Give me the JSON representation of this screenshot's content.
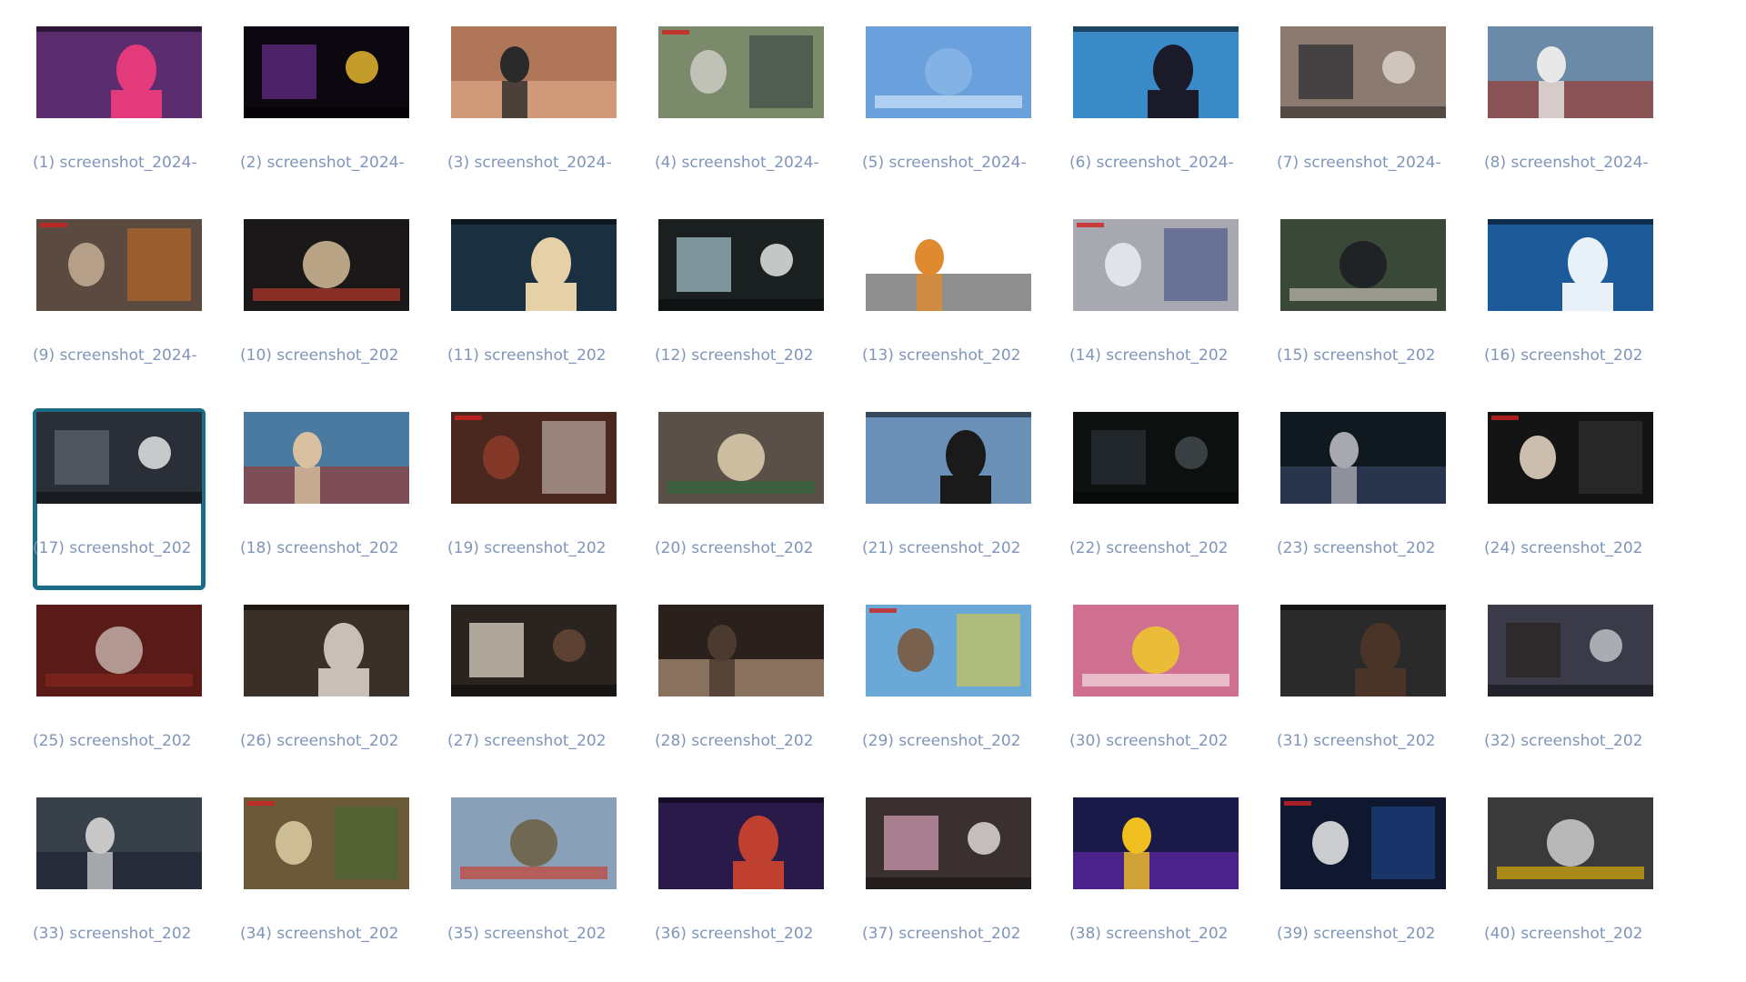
{
  "items": [
    {
      "label": "(1) screenshot_2024-",
      "icon": "studio-show-thumbnail"
    },
    {
      "label": "(2) screenshot_2024-",
      "icon": "dark-screen-thumbnail"
    },
    {
      "label": "(3) screenshot_2024-",
      "icon": "woman-phone-thumbnail"
    },
    {
      "label": "(4) screenshot_2024-",
      "icon": "reporter-field-thumbnail"
    },
    {
      "label": "(5) screenshot_2024-",
      "icon": "blue-screen-thumbnail"
    },
    {
      "label": "(6) screenshot_2024-",
      "icon": "news-anchor-thumbnail"
    },
    {
      "label": "(7) screenshot_2024-",
      "icon": "street-reporter-thumbnail"
    },
    {
      "label": "(8) screenshot_2024-",
      "icon": "motorcycle-thumbnail"
    },
    {
      "label": "(9) screenshot_2024-",
      "icon": "kitchen-thumbnail"
    },
    {
      "label": "(10) screenshot_202",
      "icon": "night-street-thumbnail"
    },
    {
      "label": "(11) screenshot_202",
      "icon": "blonde-woman-thumbnail"
    },
    {
      "label": "(12) screenshot_202",
      "icon": "monitor-scene-thumbnail"
    },
    {
      "label": "(13) screenshot_202",
      "icon": "white-screen-thumbnail"
    },
    {
      "label": "(14) screenshot_202",
      "icon": "woman-bathroom-thumbnail"
    },
    {
      "label": "(15) screenshot_202",
      "icon": "man-garden-thumbnail"
    },
    {
      "label": "(16) screenshot_202",
      "icon": "channel-logo-thumbnail"
    },
    {
      "label": "(17) screenshot_202",
      "icon": "car-ad-thumbnail"
    },
    {
      "label": "(18) screenshot_202",
      "icon": "boat-scene-thumbnail"
    },
    {
      "label": "(19) screenshot_202",
      "icon": "interview-thumbnail"
    },
    {
      "label": "(20) screenshot_202",
      "icon": "office-woman-thumbnail"
    },
    {
      "label": "(21) screenshot_202",
      "icon": "lab-woman-thumbnail"
    },
    {
      "label": "(22) screenshot_202",
      "icon": "dark-room-thumbnail"
    },
    {
      "label": "(23) screenshot_202",
      "icon": "dark-office-thumbnail"
    },
    {
      "label": "(24) screenshot_202",
      "icon": "conference-thumbnail"
    },
    {
      "label": "(25) screenshot_202",
      "icon": "red-room-thumbnail"
    },
    {
      "label": "(26) screenshot_202",
      "icon": "desk-man-thumbnail"
    },
    {
      "label": "(27) screenshot_202",
      "icon": "hallway-thumbnail"
    },
    {
      "label": "(28) screenshot_202",
      "icon": "closeup-woman-thumbnail"
    },
    {
      "label": "(29) screenshot_202",
      "icon": "cartoon-thumbnail"
    },
    {
      "label": "(30) screenshot_202",
      "icon": "cartoon-pink-thumbnail"
    },
    {
      "label": "(31) screenshot_202",
      "icon": "office-man-thumbnail"
    },
    {
      "label": "(32) screenshot_202",
      "icon": "office-pair-thumbnail"
    },
    {
      "label": "(33) screenshot_202",
      "icon": "office-table-thumbnail"
    },
    {
      "label": "(34) screenshot_202",
      "icon": "flood-street-thumbnail"
    },
    {
      "label": "(35) screenshot_202",
      "icon": "flood-field-thumbnail"
    },
    {
      "label": "(36) screenshot_202",
      "icon": "talk-show-thumbnail"
    },
    {
      "label": "(37) screenshot_202",
      "icon": "sofa-scene-thumbnail"
    },
    {
      "label": "(38) screenshot_202",
      "icon": "guide-screen-thumbnail"
    },
    {
      "label": "(39) screenshot_202",
      "icon": "epg-menu-thumbnail"
    },
    {
      "label": "(40) screenshot_202",
      "icon": "bw-scene-thumbnail"
    }
  ],
  "selected_index": 16,
  "thumbs": [
    {
      "bg": "#5b2c6e",
      "fg": "#e23a7a",
      "ac": "#8fd3f4"
    },
    {
      "bg": "#0c0810",
      "fg": "#6a2c8e",
      "ac": "#f0c030"
    },
    {
      "bg": "#b0765a",
      "fg": "#e4b090",
      "ac": "#2a2a2a"
    },
    {
      "bg": "#7a8a6a",
      "fg": "#2a2f3a",
      "ac": "#c8c8c0"
    },
    {
      "bg": "#6aa0dc",
      "fg": "#8ab6e6",
      "ac": "#e0ecf8"
    },
    {
      "bg": "#3a8ac8",
      "fg": "#1a1a28",
      "ac": "#e8c8b0"
    },
    {
      "bg": "#8a7a70",
      "fg": "#2a2a30",
      "ac": "#e0d8d0"
    },
    {
      "bg": "#6a8aa8",
      "fg": "#a03020",
      "ac": "#e8e8e8"
    },
    {
      "bg": "#5a4a40",
      "fg": "#d8701e",
      "ac": "#c0a890"
    },
    {
      "bg": "#1a1818",
      "fg": "#e0c8a0",
      "ac": "#d04030"
    },
    {
      "bg": "#1a3040",
      "fg": "#e6d0a8",
      "ac": "#3a6a8a"
    },
    {
      "bg": "#1a2020",
      "fg": "#a8c8d0",
      "ac": "#f0f0f0"
    },
    {
      "bg": "#ffffff",
      "fg": "#444444",
      "ac": "#e08a30"
    },
    {
      "bg": "#a8a8b0",
      "fg": "#2a3a7a",
      "ac": "#e8e8f0"
    },
    {
      "bg": "#3a4838",
      "fg": "#1a1a20",
      "ac": "#d8d0c8"
    },
    {
      "bg": "#1c5a9a",
      "fg": "#e8f0f8",
      "ac": "#4a88c8"
    },
    {
      "bg": "#2a2e36",
      "fg": "#606870",
      "ac": "#f0f0f0"
    },
    {
      "bg": "#4a7aa0",
      "fg": "#a03028",
      "ac": "#d8c0a0"
    },
    {
      "bg": "#4a2820",
      "fg": "#e8e0d8",
      "ac": "#8a3a28"
    },
    {
      "bg": "#5a5048",
      "fg": "#e8d8b8",
      "ac": "#2a6a3a"
    },
    {
      "bg": "#6a90b8",
      "fg": "#1a1a1a",
      "ac": "#e8d0c8"
    },
    {
      "bg": "#0e1010",
      "fg": "#2a3238",
      "ac": "#444c50"
    },
    {
      "bg": "#101820",
      "fg": "#3a4a6a",
      "ac": "#a8a8b0"
    },
    {
      "bg": "#141414",
      "fg": "#3a3a3a",
      "ac": "#e0d0c0"
    },
    {
      "bg": "#5a1a18",
      "fg": "#c8b8b0",
      "ac": "#8a2a20"
    },
    {
      "bg": "#3a3028",
      "fg": "#c8c0b8",
      "ac": "#6a5040"
    },
    {
      "bg": "#2a2420",
      "fg": "#e8e0d0",
      "ac": "#6a4a38"
    },
    {
      "bg": "#2a201c",
      "fg": "#c8a888",
      "ac": "#4a3a30"
    },
    {
      "bg": "#6aa8d8",
      "fg": "#f0d020",
      "ac": "#7a5a40"
    },
    {
      "bg": "#d07090",
      "fg": "#f0d020",
      "ac": "#f8f0f0"
    },
    {
      "bg": "#2a2a2a",
      "fg": "#4a3428",
      "ac": "#e8e8e8"
    },
    {
      "bg": "#3a3a48",
      "fg": "#2a2420",
      "ac": "#c8c8d0"
    },
    {
      "bg": "#38404a",
      "fg": "#1a2030",
      "ac": "#c8c8c8"
    },
    {
      "bg": "#6a5a3a",
      "fg": "#3a6a2a",
      "ac": "#d8c8a0"
    },
    {
      "bg": "#8aa0b8",
      "fg": "#6a5a3a",
      "ac": "#d03020"
    },
    {
      "bg": "#2a1a4a",
      "fg": "#c04030",
      "ac": "#40b8a0"
    },
    {
      "bg": "#3a3030",
      "fg": "#d8a0b8",
      "ac": "#e8e0e0"
    },
    {
      "bg": "#1a1a48",
      "fg": "#6a2ab8",
      "ac": "#f0c020"
    },
    {
      "bg": "#101830",
      "fg": "#2050a0",
      "ac": "#e0e0e0"
    },
    {
      "bg": "#3a3a3a",
      "fg": "#d8d8d8",
      "ac": "#f0c000"
    }
  ],
  "colors": {
    "label": "#7f95b9",
    "selection_border": "#1b6d86",
    "background": "#ffffff"
  }
}
